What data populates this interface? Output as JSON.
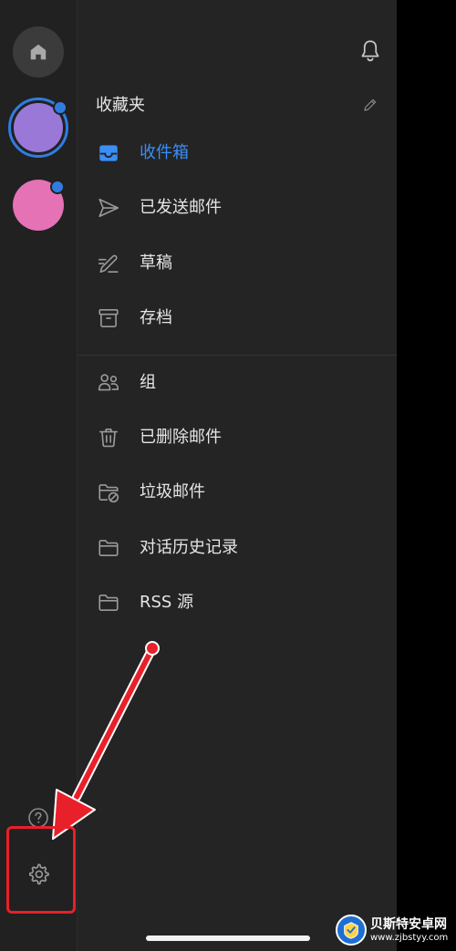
{
  "sidebar": {
    "accounts": [
      {
        "name": "account-1",
        "color": "#9a78d8",
        "has_notification": true,
        "selected": true
      },
      {
        "name": "account-2",
        "color": "#e472b5",
        "has_notification": true,
        "selected": false
      }
    ],
    "home_icon": "home-icon",
    "help_icon": "help-icon",
    "settings_icon": "gear-icon"
  },
  "pane": {
    "bell_icon": "bell-icon",
    "favorites_title": "收藏夹",
    "edit_icon": "pencil-icon",
    "favorites": [
      {
        "label": "收件箱",
        "icon": "inbox-icon",
        "active": true
      },
      {
        "label": "已发送邮件",
        "icon": "send-icon",
        "active": false
      },
      {
        "label": "草稿",
        "icon": "draft-icon",
        "active": false
      },
      {
        "label": "存档",
        "icon": "archive-icon",
        "active": false
      }
    ],
    "folders": [
      {
        "label": "组",
        "icon": "groups-icon"
      },
      {
        "label": "已删除邮件",
        "icon": "trash-icon"
      },
      {
        "label": "垃圾邮件",
        "icon": "junk-folder-icon"
      },
      {
        "label": "对话历史记录",
        "icon": "folder-icon"
      },
      {
        "label": "RSS 源",
        "icon": "folder-icon"
      }
    ]
  },
  "watermark": {
    "title": "贝斯特安卓网",
    "url": "www.zjbstyy.com"
  },
  "colors": {
    "accent": "#3a8ef6",
    "annotation": "#e8202a",
    "pane_bg": "#242424",
    "rail_bg": "#212121"
  }
}
